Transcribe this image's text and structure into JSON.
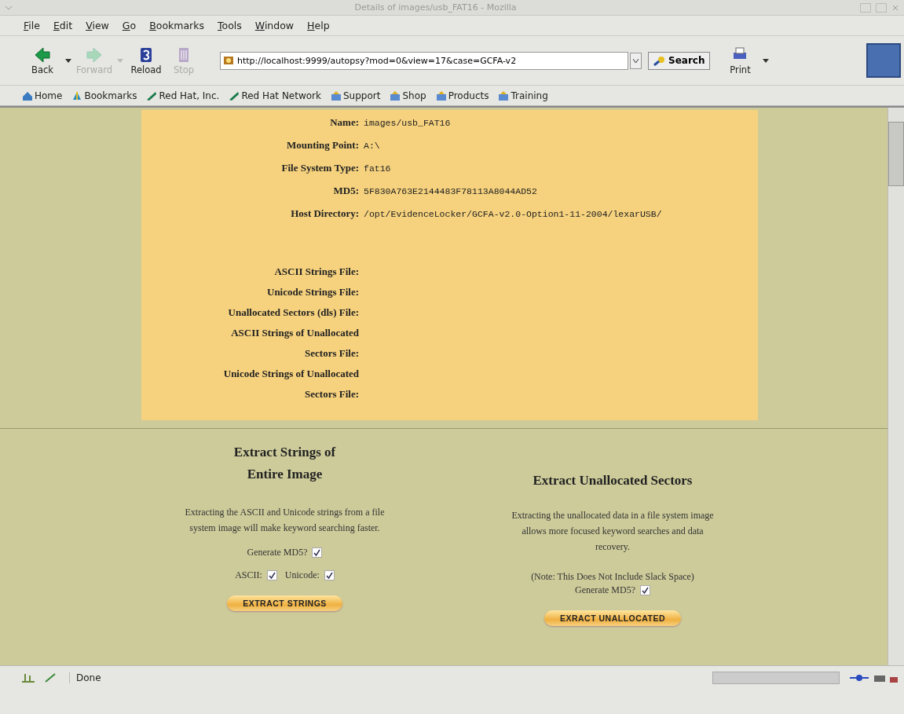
{
  "window": {
    "title": "Details of images/usb_FAT16 - Mozilla"
  },
  "menu": [
    "File",
    "Edit",
    "View",
    "Go",
    "Bookmarks",
    "Tools",
    "Window",
    "Help"
  ],
  "toolbar": {
    "buttons": [
      {
        "kind": "back",
        "label": "Back",
        "disabled": false
      },
      {
        "kind": "forward",
        "label": "Forward",
        "disabled": true
      },
      {
        "kind": "reload",
        "label": "Reload",
        "disabled": false
      },
      {
        "kind": "stop",
        "label": "Stop",
        "disabled": true
      }
    ],
    "url": "http://localhost:9999/autopsy?mod=0&view=17&case=GCFA-v2",
    "search": "Search",
    "print": "Print"
  },
  "bookmarks": [
    {
      "kind": "home",
      "label": "Home"
    },
    {
      "kind": "bookmarks",
      "label": "Bookmarks"
    },
    {
      "kind": "link",
      "label": "Red Hat, Inc."
    },
    {
      "kind": "link",
      "label": "Red Hat Network"
    },
    {
      "kind": "folder",
      "label": "Support"
    },
    {
      "kind": "folder",
      "label": "Shop"
    },
    {
      "kind": "folder",
      "label": "Products"
    },
    {
      "kind": "folder",
      "label": "Training"
    }
  ],
  "details": [
    {
      "label": "Name:",
      "value": "images/usb_FAT16"
    },
    {
      "label": "Mounting Point:",
      "value": "A:\\"
    },
    {
      "label": "File System Type:",
      "value": "fat16"
    },
    {
      "label": "MD5:",
      "value": "5F830A763E2144483F78113A8044AD52"
    },
    {
      "label": "Host Directory:",
      "value": "/opt/EvidenceLocker/GCFA-v2.0-Option1-11-2004/lexarUSB/"
    }
  ],
  "files": [
    {
      "label": "ASCII Strings File:"
    },
    {
      "label": "Unicode Strings File:"
    },
    {
      "label": "Unallocated Sectors (dls) File:"
    },
    {
      "label": "ASCII Strings of Unallocated Sectors File:"
    },
    {
      "label": "Unicode Strings of Unallocated Sectors File:"
    }
  ],
  "sections": [
    {
      "title": "Extract Strings of Entire Image",
      "description": "Extracting the ASCII and Unicode strings from a file system image will make keyword searching faster.",
      "option_rows": [
        [
          {
            "label": "Generate MD5?",
            "checked": true
          }
        ],
        [
          {
            "label": "ASCII:",
            "checked": true
          },
          {
            "label": "Unicode:",
            "checked": true
          }
        ]
      ],
      "button": "EXTRACT STRINGS"
    },
    {
      "title": "Extract Unallocated Sectors",
      "description": "Extracting the unallocated data in a file system image allows more focused keyword searches and data recovery.",
      "note": "(Note: This Does Not Include Slack Space)",
      "option_rows": [
        [
          {
            "label": "Generate MD5?",
            "checked": true
          }
        ]
      ],
      "button": "EXRACT UNALLOCATED"
    }
  ],
  "status_bar": {
    "text": "Done"
  }
}
